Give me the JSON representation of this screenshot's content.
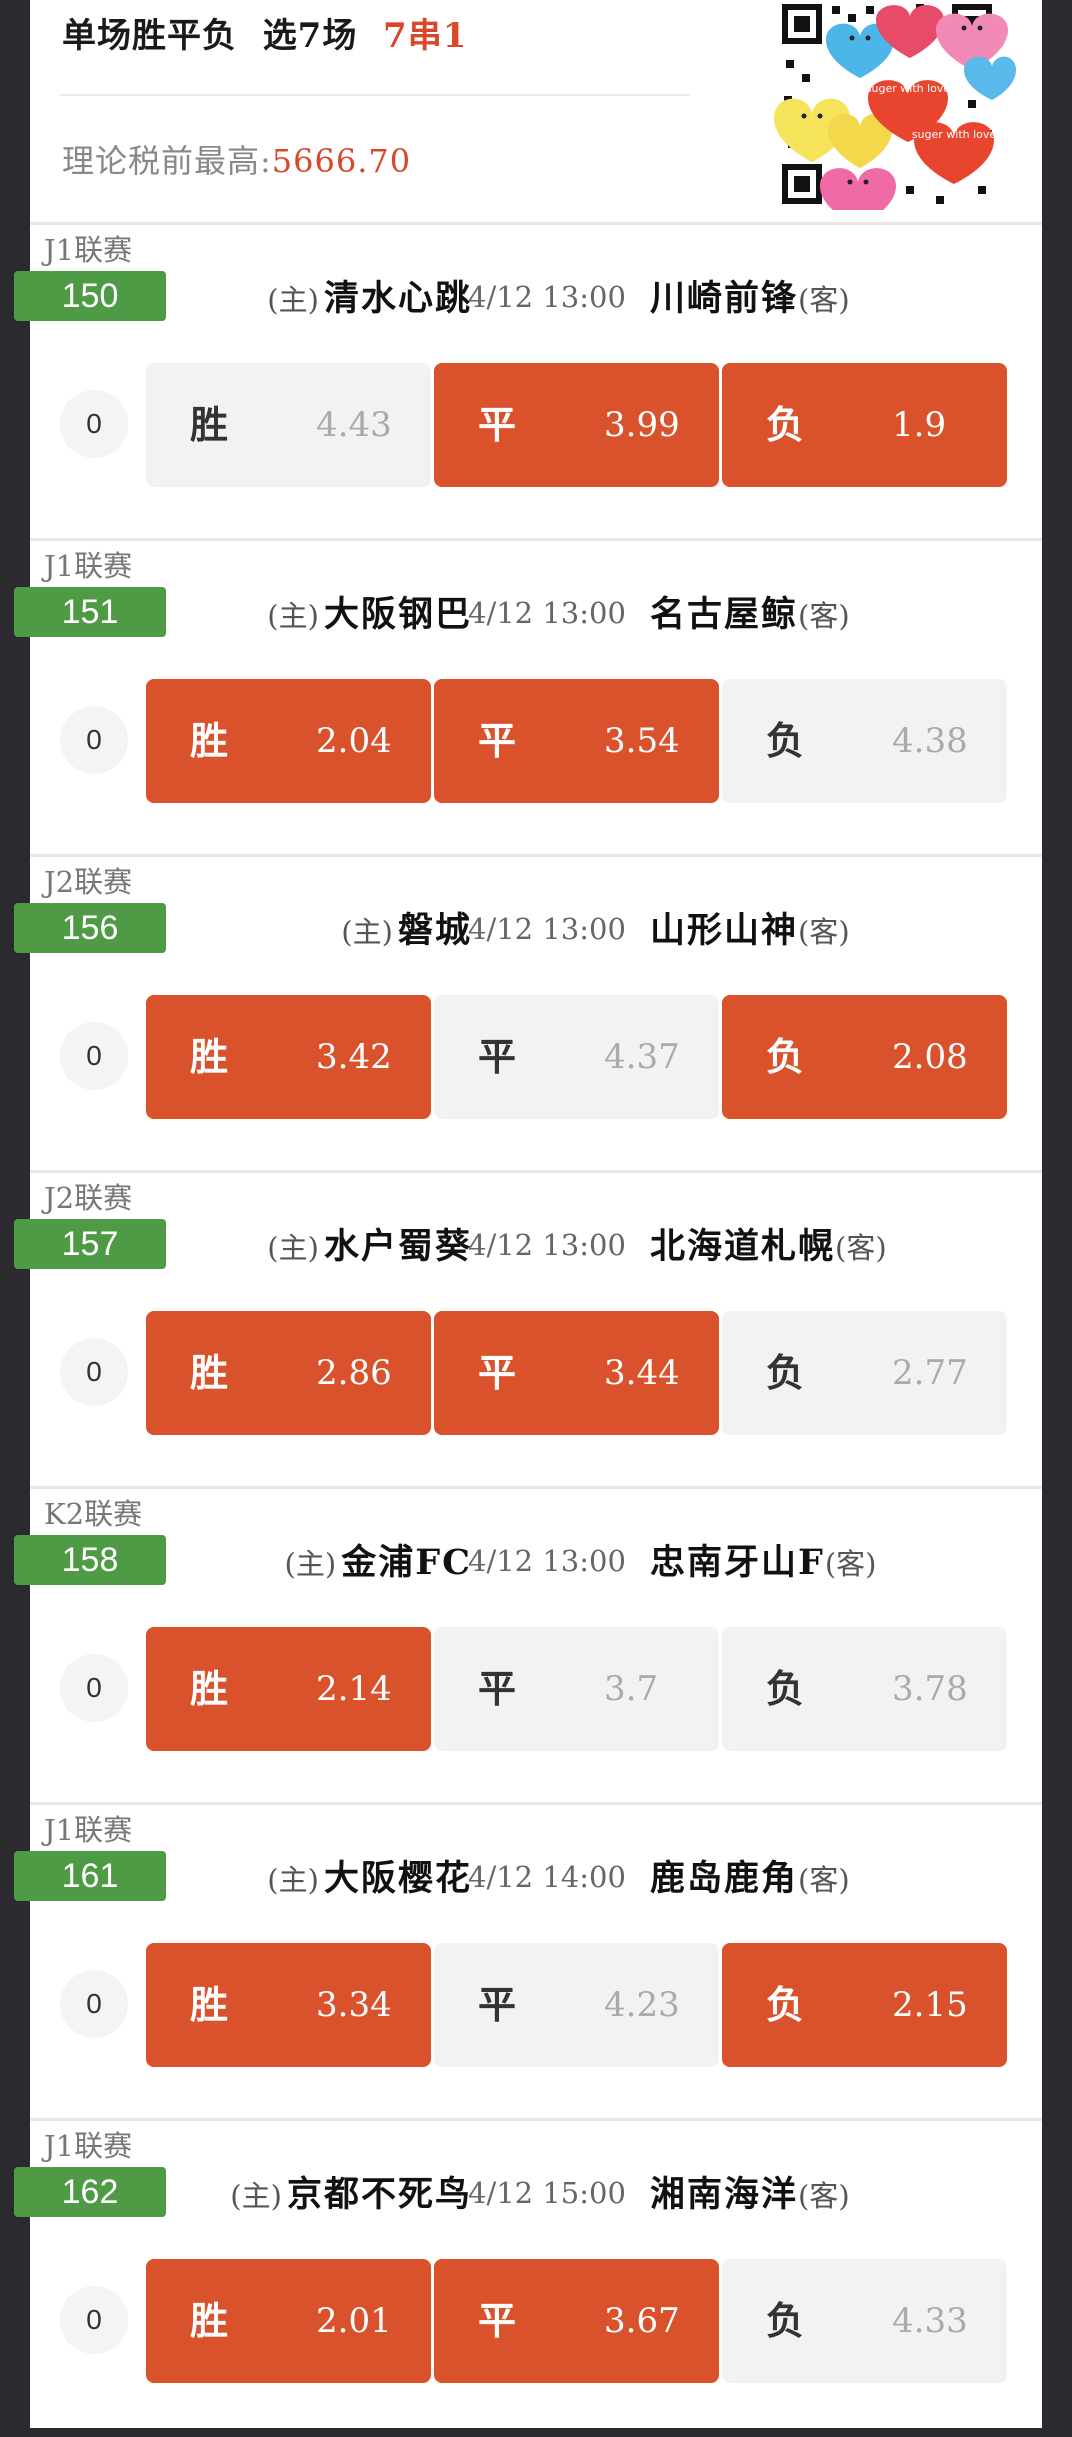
{
  "header": {
    "title_prefix": "单场胜平负",
    "title_select": "选7场",
    "title_combo": "7串1",
    "max_label": "理论税前最高:",
    "max_value": "5666.70"
  },
  "matches": [
    {
      "league": "J1联赛",
      "number": "150",
      "home_tag": "(主)",
      "home": "清水心跳",
      "time": "4/12 13:00",
      "away": "川崎前锋",
      "away_tag": "(客)",
      "multiplier": "0",
      "options": [
        {
          "label": "胜",
          "odds": "4.43",
          "selected": false
        },
        {
          "label": "平",
          "odds": "3.99",
          "selected": true
        },
        {
          "label": "负",
          "odds": "1.9",
          "selected": true
        }
      ]
    },
    {
      "league": "J1联赛",
      "number": "151",
      "home_tag": "(主)",
      "home": "大阪钢巴",
      "time": "4/12 13:00",
      "away": "名古屋鲸",
      "away_tag": "(客)",
      "multiplier": "0",
      "options": [
        {
          "label": "胜",
          "odds": "2.04",
          "selected": true
        },
        {
          "label": "平",
          "odds": "3.54",
          "selected": true
        },
        {
          "label": "负",
          "odds": "4.38",
          "selected": false
        }
      ]
    },
    {
      "league": "J2联赛",
      "number": "156",
      "home_tag": "(主)",
      "home": "磐城",
      "time": "4/12 13:00",
      "away": "山形山神",
      "away_tag": "(客)",
      "multiplier": "0",
      "options": [
        {
          "label": "胜",
          "odds": "3.42",
          "selected": true
        },
        {
          "label": "平",
          "odds": "4.37",
          "selected": false
        },
        {
          "label": "负",
          "odds": "2.08",
          "selected": true
        }
      ]
    },
    {
      "league": "J2联赛",
      "number": "157",
      "home_tag": "(主)",
      "home": "水户蜀葵",
      "time": "4/12 13:00",
      "away": "北海道札幌",
      "away_tag": "(客)",
      "multiplier": "0",
      "options": [
        {
          "label": "胜",
          "odds": "2.86",
          "selected": true
        },
        {
          "label": "平",
          "odds": "3.44",
          "selected": true
        },
        {
          "label": "负",
          "odds": "2.77",
          "selected": false
        }
      ]
    },
    {
      "league": "K2联赛",
      "number": "158",
      "home_tag": "(主)",
      "home": "金浦FC",
      "time": "4/12 13:00",
      "away": "忠南牙山F",
      "away_tag": "(客)",
      "multiplier": "0",
      "options": [
        {
          "label": "胜",
          "odds": "2.14",
          "selected": true
        },
        {
          "label": "平",
          "odds": "3.7",
          "selected": false
        },
        {
          "label": "负",
          "odds": "3.78",
          "selected": false
        }
      ]
    },
    {
      "league": "J1联赛",
      "number": "161",
      "home_tag": "(主)",
      "home": "大阪樱花",
      "time": "4/12 14:00",
      "away": "鹿岛鹿角",
      "away_tag": "(客)",
      "multiplier": "0",
      "options": [
        {
          "label": "胜",
          "odds": "3.34",
          "selected": true
        },
        {
          "label": "平",
          "odds": "4.23",
          "selected": false
        },
        {
          "label": "负",
          "odds": "2.15",
          "selected": true
        }
      ]
    },
    {
      "league": "J1联赛",
      "number": "162",
      "home_tag": "(主)",
      "home": "京都不死鸟",
      "time": "4/12 15:00",
      "away": "湘南海洋",
      "away_tag": "(客)",
      "multiplier": "0",
      "options": [
        {
          "label": "胜",
          "odds": "2.01",
          "selected": true
        },
        {
          "label": "平",
          "odds": "3.67",
          "selected": true
        },
        {
          "label": "负",
          "odds": "4.33",
          "selected": false
        }
      ]
    }
  ],
  "colors": {
    "selected": "#d9522c",
    "number_badge": "#4e9a45",
    "accent": "#d9472b"
  },
  "sticker_text": "suger with love"
}
